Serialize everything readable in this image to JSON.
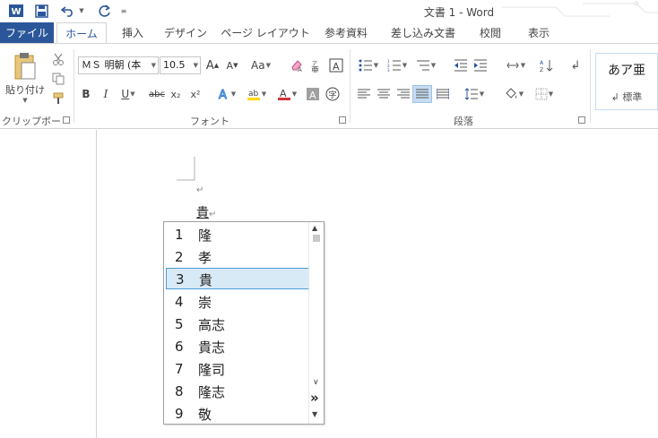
{
  "app": {
    "title": "文書 1 - Word"
  },
  "tabs": [
    {
      "label": "ファイル"
    },
    {
      "label": "ホーム"
    },
    {
      "label": "挿入"
    },
    {
      "label": "デザイン"
    },
    {
      "label": "ページ レイアウト"
    },
    {
      "label": "参考資料"
    },
    {
      "label": "差し込み文書"
    },
    {
      "label": "校閲"
    },
    {
      "label": "表示"
    }
  ],
  "ribbon": {
    "clipboard": {
      "paste_label": "貼り付け",
      "group_label": "クリップボード"
    },
    "font": {
      "font_name": "ＭＳ 明朝 (本",
      "font_size": "10.5",
      "change_case": "Aa",
      "bold": "B",
      "italic": "I",
      "underline": "U",
      "strike": "abc",
      "sub": "x₂",
      "sup": "x²",
      "enlarge": "A",
      "shrink": "A",
      "group_label": "フォント"
    },
    "paragraph": {
      "group_label": "段落"
    },
    "styles": {
      "preview": "あア亜",
      "name": "標準"
    }
  },
  "document": {
    "para_mark": "↵",
    "composed_text": "貴"
  },
  "candidates": {
    "selected_index": 2,
    "items": [
      {
        "num": "1",
        "word": "隆"
      },
      {
        "num": "2",
        "word": "孝"
      },
      {
        "num": "3",
        "word": "貴"
      },
      {
        "num": "4",
        "word": "崇"
      },
      {
        "num": "5",
        "word": "高志"
      },
      {
        "num": "6",
        "word": "貴志"
      },
      {
        "num": "7",
        "word": "隆司"
      },
      {
        "num": "8",
        "word": "隆志"
      },
      {
        "num": "9",
        "word": "敬"
      }
    ],
    "expand_icon": "»"
  },
  "colors": {
    "accent": "#2b579a",
    "file_tab": "#2b579a",
    "selection_fill": "#d9eaf7",
    "selection_border": "#4a9cd6",
    "highlight_yellow": "#ffd800",
    "font_color_red": "#d13438"
  }
}
